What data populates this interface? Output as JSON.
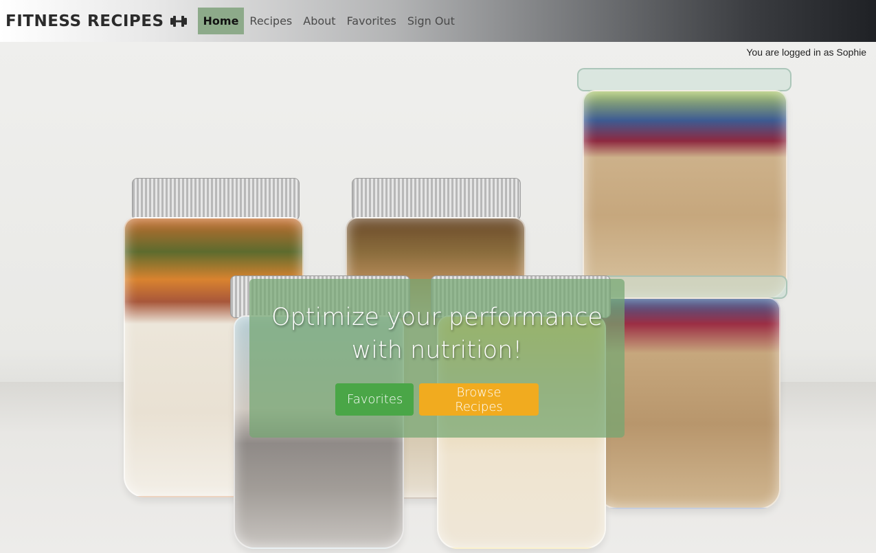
{
  "navbar": {
    "brand": "FITNESS RECIPES",
    "brand_icon": "dumbbell-icon",
    "links": [
      {
        "label": "Home",
        "active": true
      },
      {
        "label": "Recipes",
        "active": false
      },
      {
        "label": "About",
        "active": false
      },
      {
        "label": "Favorites",
        "active": false
      },
      {
        "label": "Sign Out",
        "active": false
      }
    ],
    "active_color": "#8daa8a"
  },
  "user": {
    "status_text": "You are logged in as Sophie"
  },
  "hero": {
    "headline": "Optimize your performance with nutrition!",
    "buttons": {
      "favorites_label": "Favorites",
      "browse_label": "Browse Recipes"
    },
    "colors": {
      "favorites": "#4aa647",
      "browse": "#f1ab1f",
      "overlay": "#74a671"
    }
  }
}
